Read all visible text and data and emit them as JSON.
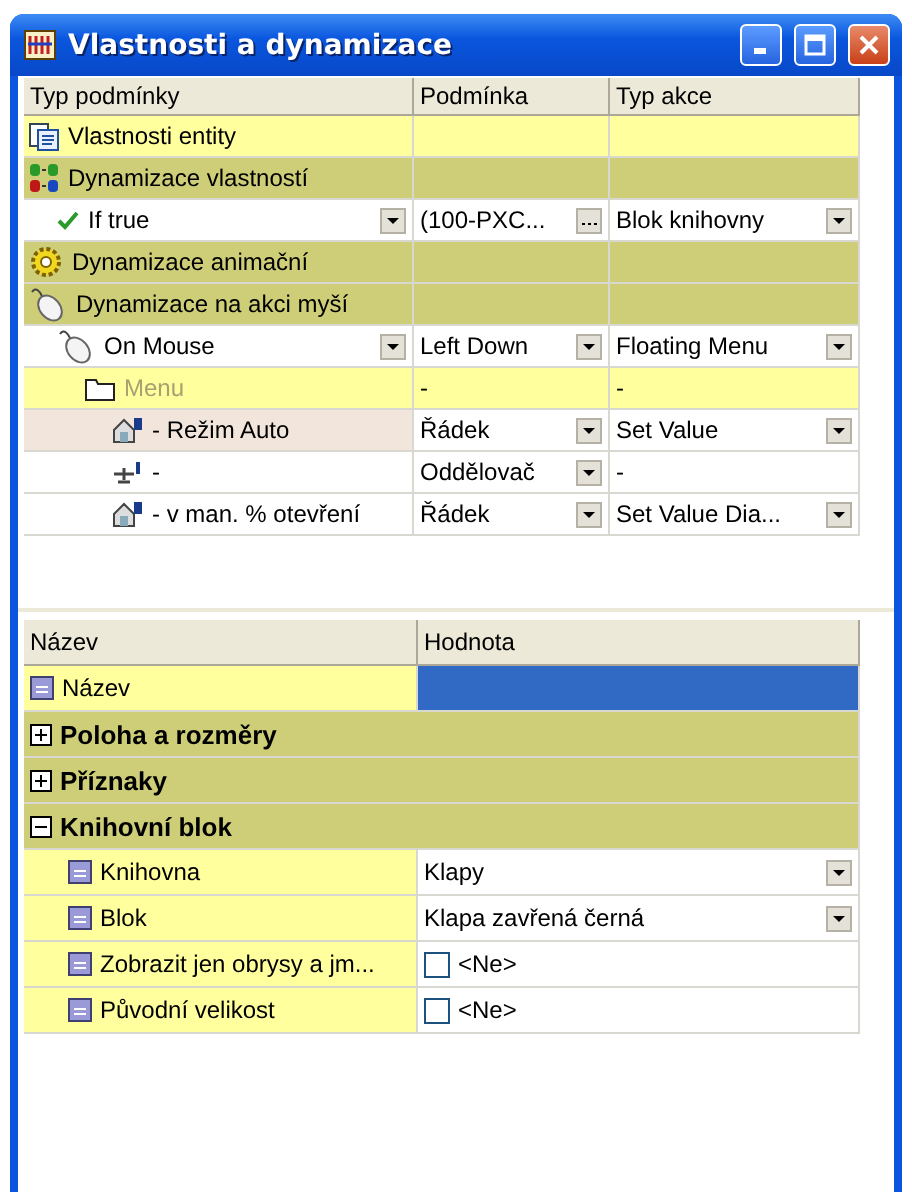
{
  "window": {
    "title": "Vlastnosti a dynamizace"
  },
  "conditions": {
    "columns": [
      "Typ podmínky",
      "Podmínka",
      "Typ akce"
    ],
    "rows": [
      {
        "kind": "properties",
        "label": "Vlastnosti entity"
      },
      {
        "kind": "dynamics",
        "label": "Dynamizace vlastností",
        "children": [
          {
            "kind": "if",
            "label": "If true",
            "dropdown": true,
            "condition": {
              "text": "(100-PXC...",
              "ellipsis": true
            },
            "action": {
              "text": "Blok knihovny",
              "dropdown": true
            }
          }
        ]
      },
      {
        "kind": "animation",
        "label": "Dynamizace animační"
      },
      {
        "kind": "mouse",
        "label": "Dynamizace na akci myší",
        "children": [
          {
            "kind": "mouse-event",
            "label": "On Mouse",
            "dropdown": true,
            "condition": {
              "text": "Left Down",
              "dropdown": true
            },
            "action": {
              "text": "Floating Menu",
              "dropdown": true
            },
            "children": [
              {
                "kind": "menu",
                "label": "Menu",
                "condition": {
                  "text": "-"
                },
                "action": {
                  "text": "-"
                },
                "children": [
                  {
                    "kind": "item",
                    "label": "- Režim Auto",
                    "selected": true,
                    "condition": {
                      "text": "Řádek",
                      "dropdown": true
                    },
                    "action": {
                      "text": "Set Value",
                      "dropdown": true
                    }
                  },
                  {
                    "kind": "separator",
                    "label": "-",
                    "selected": false,
                    "condition": {
                      "text": "Oddělovač",
                      "dropdown": true
                    },
                    "action": {
                      "text": "-"
                    }
                  },
                  {
                    "kind": "item",
                    "label": "- v man. % otevření",
                    "selected": false,
                    "condition": {
                      "text": "Řádek",
                      "dropdown": true
                    },
                    "action": {
                      "text": "Set Value Dia...",
                      "dropdown": true
                    }
                  }
                ]
              }
            ]
          }
        ]
      }
    ]
  },
  "properties": {
    "columns": [
      "Název",
      "Hodnota"
    ],
    "rows": [
      {
        "kind": "field",
        "label": "Název",
        "selected": true
      },
      {
        "kind": "category",
        "label": "Poloha a rozměry",
        "expanded": false
      },
      {
        "kind": "category",
        "label": "Příznaky",
        "expanded": false
      },
      {
        "kind": "category",
        "label": "Knihovní blok",
        "expanded": true,
        "children": [
          {
            "kind": "field",
            "label": "Knihovna",
            "value": "Klapy",
            "dropdown": true,
            "selected": false
          },
          {
            "kind": "field",
            "label": "Blok",
            "value": "Klapa zavřená černá",
            "dropdown": true,
            "selected": false
          },
          {
            "kind": "checkbox",
            "label": "Zobrazit jen obrysy a jm...",
            "value": "<Ne>",
            "checked": false,
            "selected": false
          },
          {
            "kind": "checkbox",
            "label": "Původní velikost",
            "value": "<Ne>",
            "checked": false,
            "selected": false
          }
        ]
      }
    ]
  }
}
